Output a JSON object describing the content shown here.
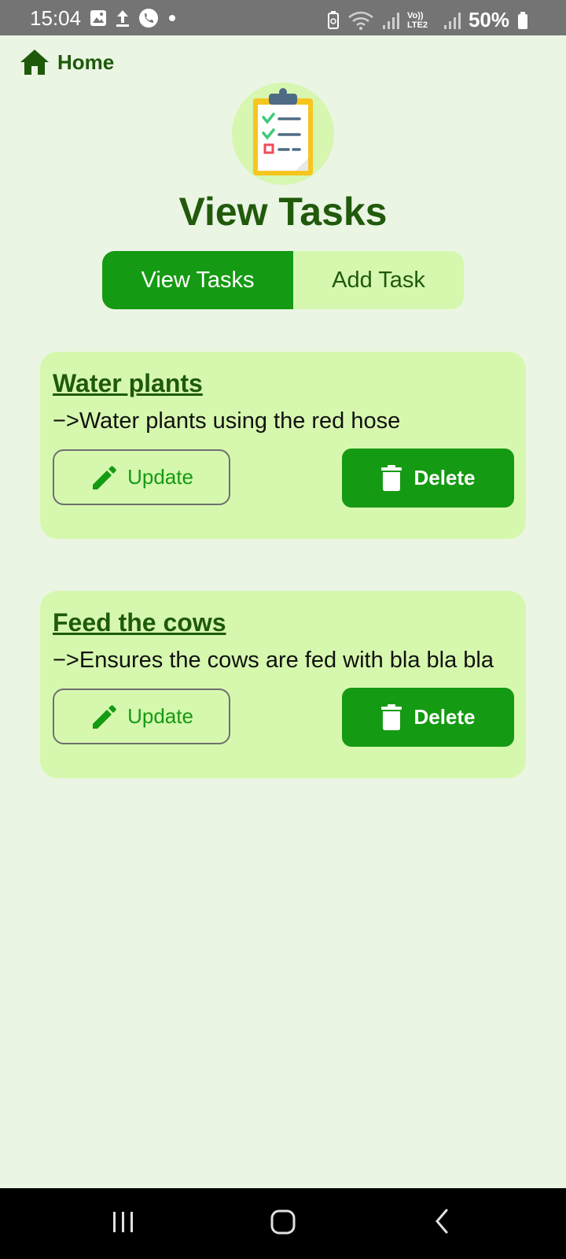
{
  "status_bar": {
    "time": "15:04",
    "battery": "50%",
    "icons_left": [
      "image-icon",
      "upload-icon",
      "call-icon",
      "dot-icon"
    ],
    "icons_right": [
      "battery-saver-icon",
      "wifi-icon",
      "signal-icon",
      "volte-icon",
      "signal-icon",
      "battery-icon"
    ],
    "network_label": "Vo)) LTE2"
  },
  "header": {
    "home_label": "Home",
    "home_icon": "home-icon",
    "page_title": "View Tasks",
    "logo_icon": "clipboard-checklist-icon"
  },
  "tabs": [
    {
      "label": "View Tasks",
      "active": true
    },
    {
      "label": "Add Task",
      "active": false
    }
  ],
  "tasks": [
    {
      "title": "Water plants",
      "description": "−>Water plants using the red hose",
      "update_label": "Update",
      "delete_label": "Delete"
    },
    {
      "title": "Feed the cows",
      "description": "−>Ensures the cows are fed with bla bla bla",
      "update_label": "Update",
      "delete_label": "Delete"
    }
  ],
  "nav_bar": {
    "buttons": [
      "recents-icon",
      "home-nav-icon",
      "back-icon"
    ]
  },
  "colors": {
    "background": "#ebf5e4",
    "card": "#d6f8ae",
    "primary": "#159a13",
    "dark_green": "#1f5a0b"
  }
}
